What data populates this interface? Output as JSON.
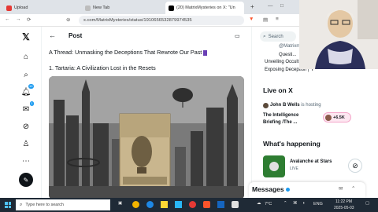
{
  "browser": {
    "tabs": [
      {
        "label": "Upload",
        "color": "#e53935"
      },
      {
        "label": "New Tab",
        "color": "#9e9e9e"
      },
      {
        "label": "(20) MatrixMysteries on X: \"Un",
        "color": "#000000"
      }
    ],
    "url": "x.com/MatrixMysteries/status/1910656532879974535"
  },
  "nav": {
    "notifications_badge": "10",
    "messages_badge": "1"
  },
  "post": {
    "back_label": "←",
    "header": "Post",
    "thread_title": "A Thread: Unmasking the Deceptions That Rewrote Our Past",
    "section": "1. Tartaria: A Civilization Lost in the Resets"
  },
  "right": {
    "search_placeholder": "Search",
    "profile_handle": "@Matrixm...",
    "profile_bio_1": "Questi...",
    "profile_bio_2": "Unveiling Occult truths |",
    "profile_bio_3": "Exposing Deception | ✝",
    "live_heading": "Live on X",
    "host_name": "John B Wells",
    "host_suffix": "is hosting",
    "space_title_1": "The Intelligence",
    "space_title_2": "Briefing /The ...",
    "listeners": "+6.5K",
    "happening_heading": "What's happening",
    "event_title": "Avalanche at Stars",
    "event_status": "LIVE",
    "messages_label": "Messages"
  },
  "taskbar": {
    "search_placeholder": "Type here to search",
    "weather": "7°C",
    "lang": "ENG",
    "time": "11:22 PM",
    "date": "2025-05-03"
  },
  "colors": {
    "accent": "#1d9bf0",
    "badge": "#1d9bf0",
    "live_pink": "#f91880"
  }
}
